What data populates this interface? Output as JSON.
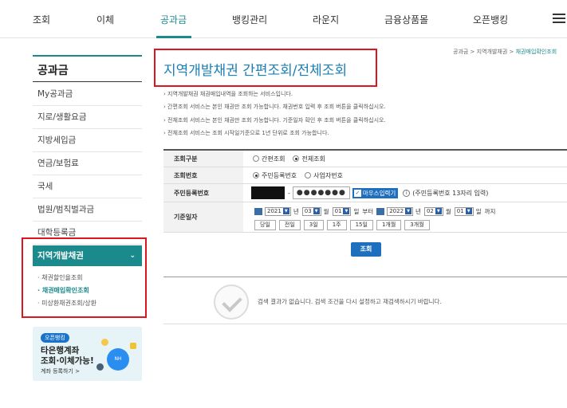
{
  "topnav": {
    "items": [
      "조회",
      "이체",
      "공과금",
      "뱅킹관리",
      "라운지",
      "금융상품몰",
      "오픈뱅킹"
    ],
    "active_index": 2
  },
  "sidebar": {
    "title": "공과금",
    "items": [
      "My공과금",
      "지로/생활요금",
      "지방세입금",
      "연금/보험료",
      "국세",
      "법원/범칙벌과금",
      "대학등록금"
    ],
    "active_item": "지역개발채권",
    "sub_items": [
      "채권할인율조회",
      "채권매입확인조회",
      "미상환채권조회/상환"
    ],
    "active_sub_index": 1
  },
  "banner": {
    "tag": "오픈뱅킹",
    "line1": "타은행계좌",
    "line2": "조회·이체가능!",
    "line3": "계좌 등록하기 >",
    "circle_text": "NH"
  },
  "breadcrumb": {
    "items": [
      "공과금",
      "지역개발채권"
    ],
    "current": "채권매입확인조회"
  },
  "page_title": "지역개발채권 간편조회/전체조회",
  "notices": [
    "지역개발채권 채권매입내역을 조회하는 서비스입니다.",
    "간편조회 서비스는 본인 채권만 조회 가능합니다. 채권번호 입력 후 조회 버튼을 클릭하십시오.",
    "전체조회 서비스는 본인 채권만 조회 가능합니다. 기준일자 확인 후 조회 버튼을 클릭하십시오.",
    "전체조회 서비스는 조회 시작일기준으로 1년 단위로 조회 가능합니다."
  ],
  "form": {
    "type_label": "조회구분",
    "type_options": [
      "간편조회",
      "전체조회"
    ],
    "type_selected": 1,
    "number_label": "조회번호",
    "number_options": [
      "주민등록번호",
      "사업자번호"
    ],
    "number_selected": 0,
    "rrn_label": "주민등록번호",
    "rrn_dash": "-",
    "rrn_mask": "●●●●●●●",
    "mouse_input_label": "마우스입력기",
    "mouse_input_checked": true,
    "rrn_hint": "(주민등록번호 13자리 입력)",
    "date_label": "기준일자",
    "start": {
      "year": "2021",
      "month": "03",
      "day": "01"
    },
    "end": {
      "year": "2022",
      "month": "02",
      "day": "01"
    },
    "unit_year": "년",
    "unit_month": "월",
    "unit_day": "일",
    "from_text": "부터",
    "to_text": "까지",
    "quick_buttons": [
      "당일",
      "전일",
      "3일",
      "1주",
      "15일",
      "1개월",
      "3개월"
    ]
  },
  "search_button": "조회",
  "result_message": "검색 결과가 없습니다. 검색 조건을 다시 설정하고 재검색하시기 바랍니다.",
  "colors": {
    "accent": "#1b8a8c",
    "title_blue": "#1b7fb5",
    "button_blue": "#1f6fbf",
    "highlight_red": "#e0141e"
  }
}
